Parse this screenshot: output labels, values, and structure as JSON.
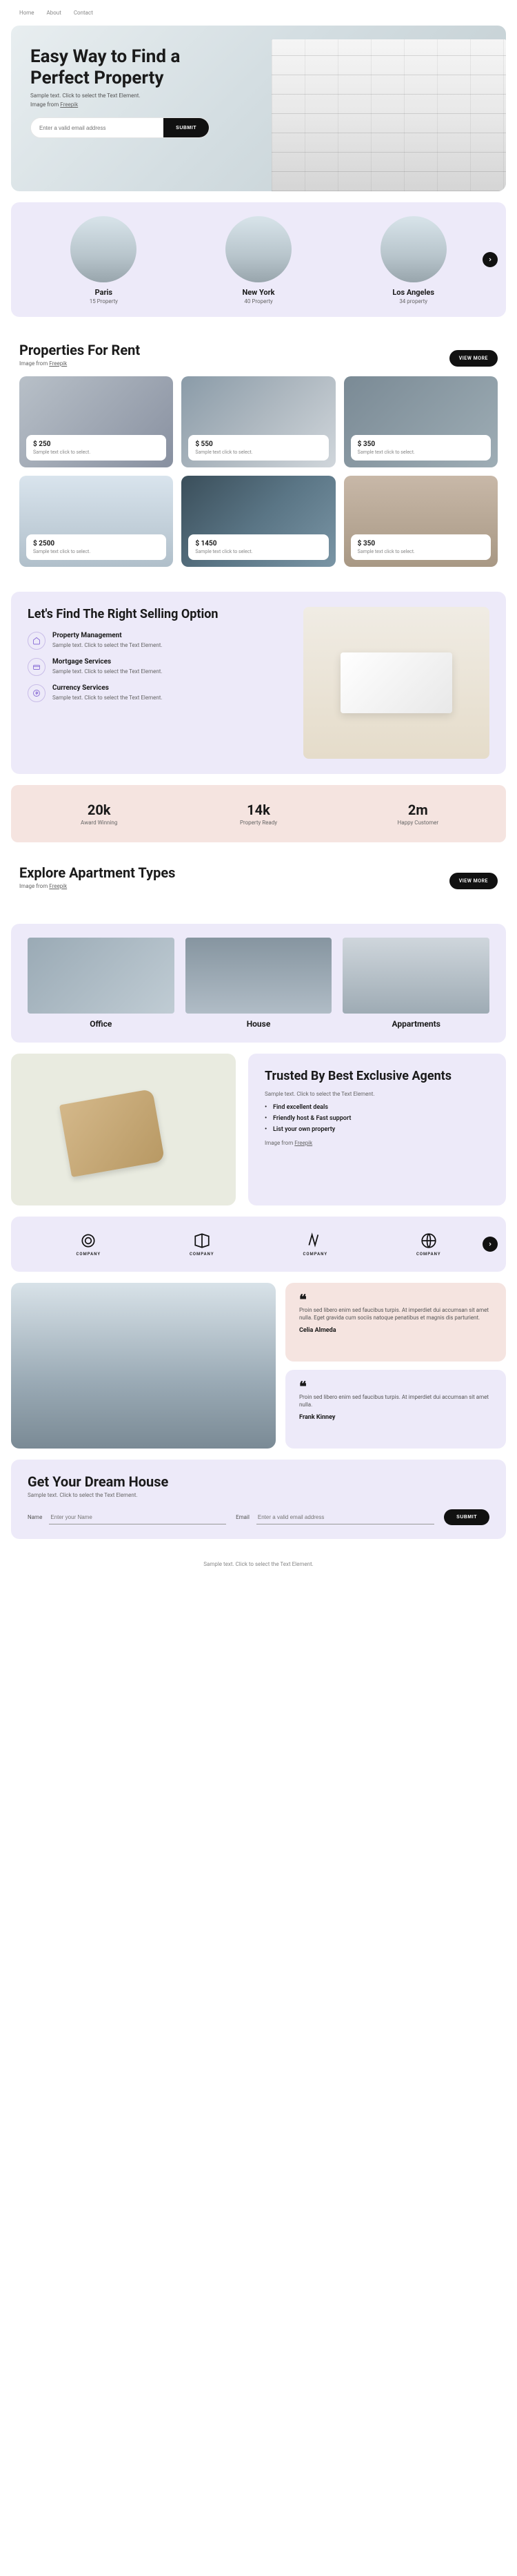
{
  "nav": {
    "items": [
      "Home",
      "About",
      "Contact"
    ]
  },
  "hero": {
    "title": "Easy Way to Find a Perfect Property",
    "subtitle": "Sample text. Click to select the Text Element.",
    "image_attr_prefix": "Image from ",
    "image_attr_link": "Freepik",
    "email_placeholder": "Enter a valid email address",
    "submit_label": "SUBMIT"
  },
  "cities": [
    {
      "name": "Paris",
      "count": "15 Property"
    },
    {
      "name": "New York",
      "count": "40 Property"
    },
    {
      "name": "Los Angeles",
      "count": "34 property"
    }
  ],
  "rent": {
    "heading": "Properties For Rent",
    "attr_prefix": "Image from ",
    "attr_link": "Freepik",
    "view_more": "VIEW MORE",
    "cards": [
      {
        "price": "$ 250",
        "desc": "Sample text click to select."
      },
      {
        "price": "$ 550",
        "desc": "Sample text click to select."
      },
      {
        "price": "$ 350",
        "desc": "Sample text click to select."
      },
      {
        "price": "$ 2500",
        "desc": "Sample text click to select."
      },
      {
        "price": "$ 1450",
        "desc": "Sample text click to select."
      },
      {
        "price": "$ 350",
        "desc": "Sample text click to select."
      }
    ]
  },
  "selling": {
    "heading": "Let's Find The Right Selling Option",
    "items": [
      {
        "title": "Property Management",
        "desc": "Sample text. Click to select the Text Element."
      },
      {
        "title": "Mortgage Services",
        "desc": "Sample text. Click to select the Text Element."
      },
      {
        "title": "Currency Services",
        "desc": "Sample text. Click to select the Text Element."
      }
    ]
  },
  "stats": [
    {
      "value": "20k",
      "label": "Award Winning"
    },
    {
      "value": "14k",
      "label": "Property Ready"
    },
    {
      "value": "2m",
      "label": "Happy Customer"
    }
  ],
  "types": {
    "heading": "Explore Apartment Types",
    "attr_prefix": "Image from ",
    "attr_link": "Freepik",
    "view_more": "VIEW MORE",
    "items": [
      "Office",
      "House",
      "Appartments"
    ]
  },
  "trusted": {
    "heading": "Trusted By Best Exclusive Agents",
    "desc": "Sample text. Click to select the Text Element.",
    "bullets": [
      "Find excellent deals",
      "Friendly host & Fast support",
      "List your own property"
    ],
    "attr_prefix": "Image from ",
    "attr_link": "Freepik"
  },
  "logos": {
    "label": "COMPANY"
  },
  "testimonials": [
    {
      "text": "Proin sed libero enim sed faucibus turpis. At imperdiet dui accumsan sit amet nulla. Eget gravida cum sociis natoque penatibus et magnis dis parturient.",
      "author": "Celia Almeda"
    },
    {
      "text": "Proin sed libero enim sed faucibus turpis. At imperdiet dui accumsan sit amet nulla.",
      "author": "Frank Kinney"
    }
  ],
  "footer": {
    "heading": "Get Your Dream House",
    "subhead": "Sample text. Click to select the Text Element.",
    "name_label": "Name",
    "name_placeholder": "Enter your Name",
    "email_label": "Email",
    "email_placeholder": "Enter a valid email address",
    "submit_label": "SUBMIT"
  },
  "footnote": "Sample text. Click to select the Text Element."
}
